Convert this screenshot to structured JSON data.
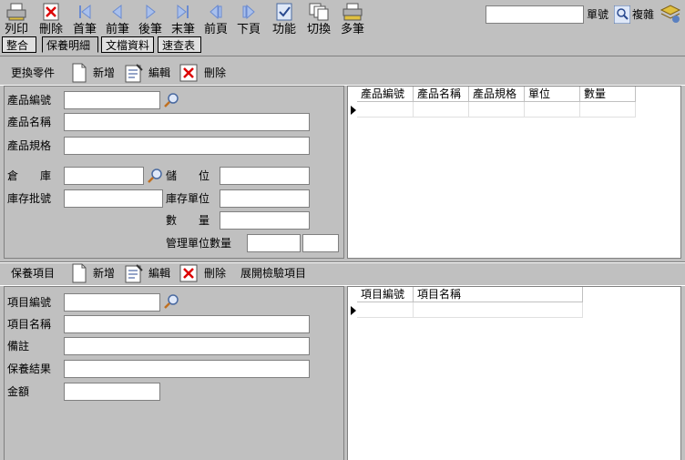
{
  "toolbar": {
    "print": "列印",
    "delete": "刪除",
    "first": "首筆",
    "prev": "前筆",
    "next": "後筆",
    "last": "末筆",
    "prev_page": "前頁",
    "next_page": "下頁",
    "function": "功能",
    "switch": "切換",
    "multi": "多筆",
    "doc_no_label": "單號",
    "copy_label": "複雜",
    "search_value": ""
  },
  "tabs": [
    {
      "label": "整合"
    },
    {
      "label": "保養明細"
    },
    {
      "label": "文檔資料"
    },
    {
      "label": "速查表"
    }
  ],
  "parts": {
    "title": "更換零件",
    "add": "新增",
    "edit": "編輯",
    "delete": "刪除",
    "labels": {
      "product_no": "產品編號",
      "product_name": "產品名稱",
      "product_spec": "產品規格",
      "warehouse": "倉　　庫",
      "location": "儲　　位",
      "batch_no": "庫存批號",
      "stock_unit": "庫存單位",
      "quantity": "數　　量",
      "mgmt_unit_qty": "管理單位數量"
    },
    "grid_headers": [
      "產品編號",
      "產品名稱",
      "產品規格",
      "單位",
      "數量"
    ]
  },
  "maintenance": {
    "title": "保養項目",
    "add": "新增",
    "edit": "編輯",
    "delete": "刪除",
    "expand": "展開檢驗項目",
    "labels": {
      "item_no": "項目編號",
      "item_name": "項目名稱",
      "remark": "備註",
      "result": "保養結果",
      "amount": "金額"
    },
    "grid_headers": [
      "項目編號",
      "項目名稱"
    ]
  }
}
